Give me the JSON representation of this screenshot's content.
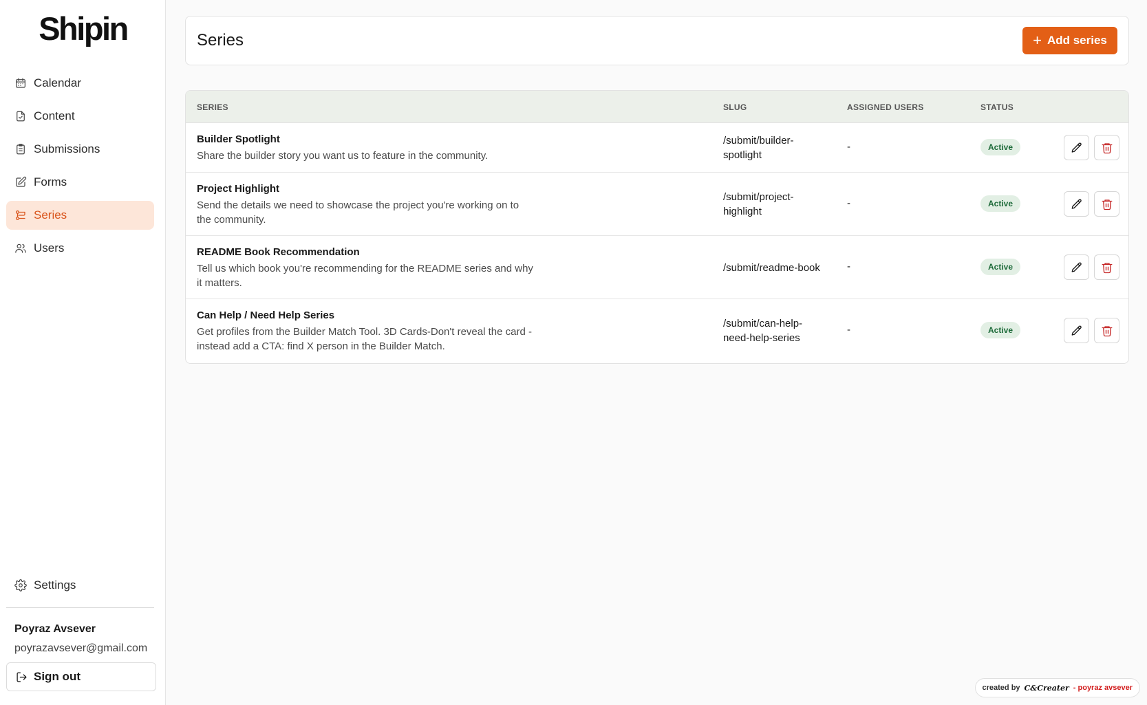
{
  "app": {
    "logo": "Shipin"
  },
  "sidebar": {
    "items": [
      {
        "label": "Calendar",
        "icon": "calendar-icon"
      },
      {
        "label": "Content",
        "icon": "content-icon"
      },
      {
        "label": "Submissions",
        "icon": "clipboard-icon"
      },
      {
        "label": "Forms",
        "icon": "edit-form-icon"
      },
      {
        "label": "Series",
        "icon": "series-icon",
        "active": true
      },
      {
        "label": "Users",
        "icon": "users-icon"
      }
    ],
    "settings_label": "Settings",
    "user": {
      "name": "Poyraz Avsever",
      "email": "poyrazavsever@gmail.com"
    },
    "signout_label": "Sign out"
  },
  "header": {
    "title": "Series",
    "add_button_label": "Add series"
  },
  "table": {
    "columns": [
      "SERIES",
      "SLUG",
      "ASSIGNED USERS",
      "STATUS"
    ],
    "rows": [
      {
        "title": "Builder Spotlight",
        "description": "Share the builder story you want us to feature in the community.",
        "slug": "/submit/builder-spotlight",
        "assigned_users": "-",
        "status": "Active"
      },
      {
        "title": "Project Highlight",
        "description": "Send the details we need to showcase the project you're working on to the community.",
        "slug": "/submit/project-highlight",
        "assigned_users": "-",
        "status": "Active"
      },
      {
        "title": "README Book Recommendation",
        "description": "Tell us which book you're recommending for the README series and why it matters.",
        "slug": "/submit/readme-book",
        "assigned_users": "-",
        "status": "Active"
      },
      {
        "title": "Can Help / Need Help Series",
        "description": "Get profiles from the Builder Match Tool. 3D Cards-Don't reveal the card - instead add a CTA: find X person in the Builder Match.",
        "slug": "/submit/can-help-need-help-series",
        "assigned_users": "-",
        "status": "Active"
      }
    ]
  },
  "credit": {
    "prefix": "created by",
    "brand": "C&Creater",
    "suffix": "- poyraz avsever"
  },
  "colors": {
    "accent": "#e35f16",
    "active_bg": "#fde6d9",
    "badge_bg": "#e2efe4",
    "badge_text": "#1e6b3a",
    "delete": "#c62828"
  }
}
